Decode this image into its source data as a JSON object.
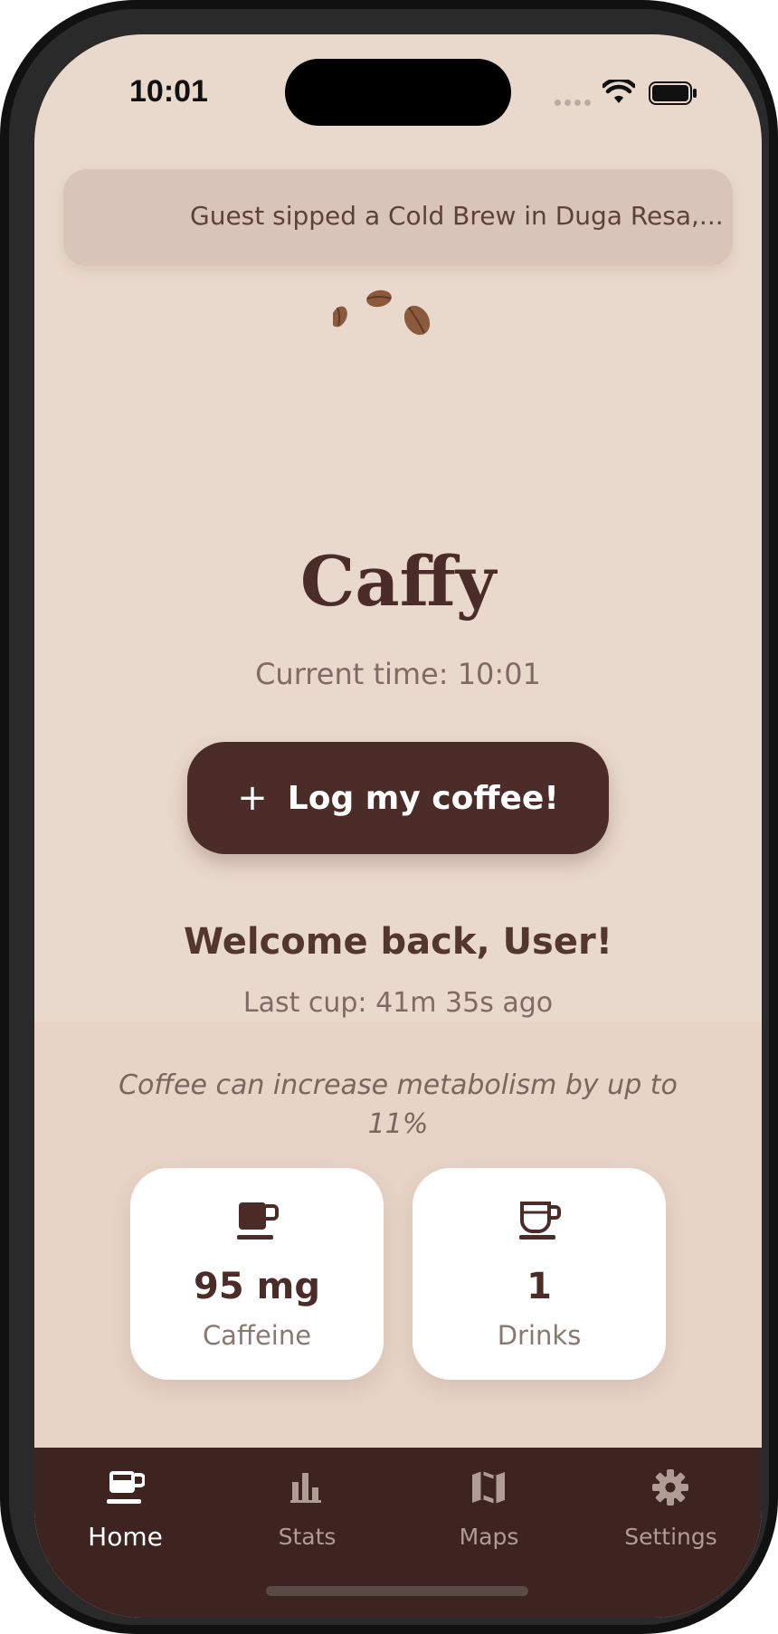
{
  "status_bar": {
    "time": "10:01"
  },
  "ticker": {
    "text": "Guest sipped a Cold Brew in Duga Resa,..."
  },
  "app": {
    "title": "Caffy",
    "current_time": "Current time: 10:01"
  },
  "log_button": {
    "icon": "+",
    "label": "Log my coffee!"
  },
  "welcome": {
    "title": "Welcome back, User!",
    "last_cup": "Last cup: 41m 35s ago"
  },
  "fact": "Coffee can increase metabolism by up to 11%",
  "stats": [
    {
      "icon": "coffee-cup-icon",
      "value": "95 mg",
      "label": "Caffeine"
    },
    {
      "icon": "coffee-glass-icon",
      "value": "1",
      "label": "Drinks"
    }
  ],
  "tabs": [
    {
      "icon": "coffee-mug-icon",
      "label": "Home",
      "active": true
    },
    {
      "icon": "bar-chart-icon",
      "label": "Stats",
      "active": false
    },
    {
      "icon": "map-icon",
      "label": "Maps",
      "active": false
    },
    {
      "icon": "gear-icon",
      "label": "Settings",
      "active": false
    }
  ],
  "colors": {
    "background": "#e9d9cc",
    "primary": "#4b2c28",
    "tabbar": "#3d2420",
    "card": "#ffffff"
  }
}
